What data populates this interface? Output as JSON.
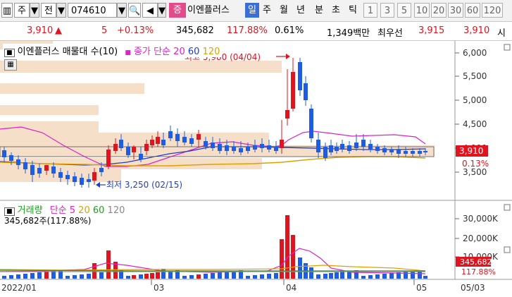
{
  "toolbar": {
    "market_label": "주",
    "mode_label": "전",
    "code": "074610",
    "search_icon": "search-icon",
    "sound_icon": "speaker-icon",
    "stock_prefix": "증",
    "stock_name": "이엔플러스",
    "periods": [
      "일",
      "주",
      "월",
      "년",
      "분",
      "초",
      "틱"
    ],
    "selected_period": "일",
    "minutes": [
      "1",
      "3",
      "5",
      "10",
      "20",
      "30",
      "60",
      "120"
    ]
  },
  "info": {
    "price": "3,910",
    "change": "5",
    "change_pct": "+0.13%",
    "volume": "345,682",
    "volume_ratio": "117.88%",
    "turnover": "0.61%",
    "amount": "1,349백만",
    "bid_label": "최우선",
    "ask": "3,915",
    "bid": "3,910",
    "time_label": "시",
    "up_color": "#e0141e"
  },
  "price_panel": {
    "legend_title": "이엔플러스 매물대 수(10)",
    "ma_label": "종가 단순",
    "ma_periods": [
      "20",
      "60",
      "120"
    ],
    "ma_colors": [
      "#e020c8",
      "#1e3cc8",
      "#e0a000"
    ],
    "high_note": "최고 5,980 (04/04)",
    "low_note": "최저 3,250 (02/15)",
    "y_ticks": [
      "6,000",
      "5,500",
      "5,000",
      "4,500",
      "4,000",
      "3,500"
    ],
    "current_price": "3,910",
    "current_pct": "0.13%"
  },
  "volume_panel": {
    "legend_title": "거래량",
    "ma_label": "단순",
    "ma_periods": [
      "5",
      "20",
      "60",
      "120"
    ],
    "ma_colors": [
      "#e020c8",
      "#e0a000",
      "#20a020",
      "#888888"
    ],
    "current_text": "345,682주(117.88%)",
    "y_ticks": [
      "30,000K",
      "20,000K",
      "10,000K"
    ],
    "current_volume": "345,682",
    "current_pct": "117.88%"
  },
  "x_axis": {
    "labels": [
      "2022/01",
      "03",
      "04",
      "05",
      "05/03"
    ]
  }
}
